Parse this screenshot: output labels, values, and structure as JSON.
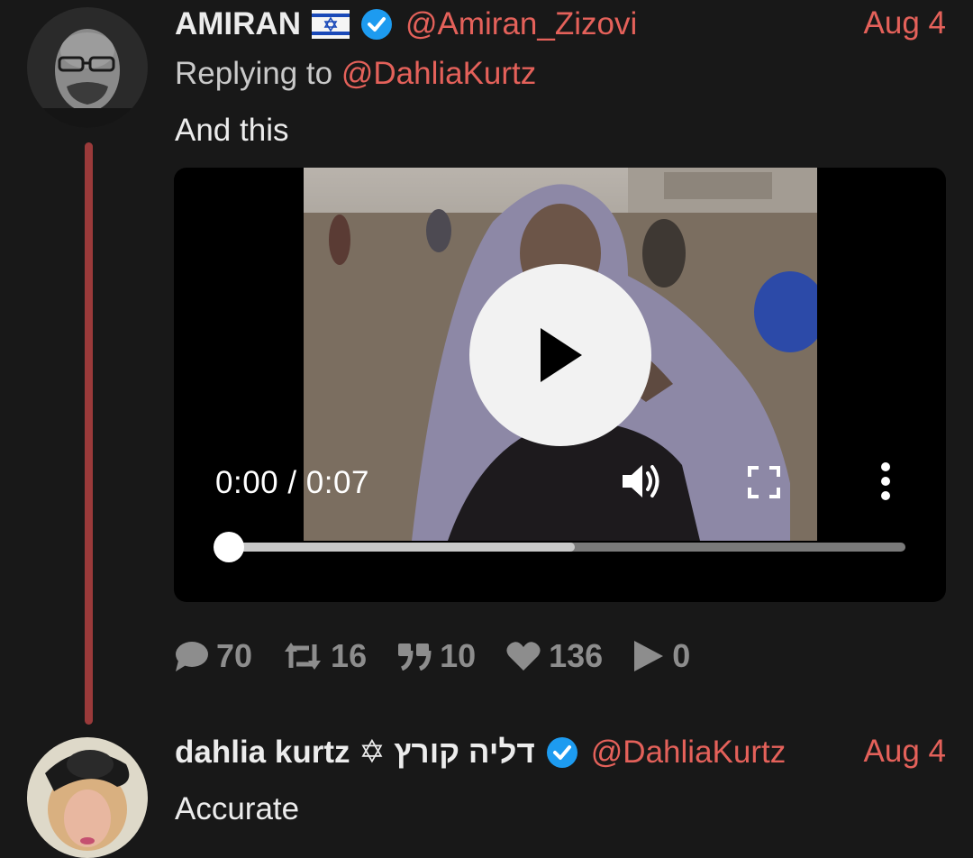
{
  "post1": {
    "name": "AMIRAN",
    "handle": "@Amiran_Zizovi",
    "date": "Aug 4",
    "replying_prefix": "Replying to ",
    "replying_handle": "@DahliaKurtz",
    "text": "And this",
    "icons": {
      "flag": "israel-flag-icon",
      "verified": "verified-badge-icon"
    },
    "video": {
      "time": "0:00 / 0:07",
      "buffered": 0.51,
      "played": 0,
      "icons": [
        "play-icon",
        "volume-icon",
        "fullscreen-icon",
        "more-vertical-icon"
      ]
    },
    "stats": {
      "replies": "70",
      "retweets": "16",
      "quotes": "10",
      "likes": "136",
      "views": "0"
    }
  },
  "post2": {
    "name": "dahlia kurtz ✡ דליה קורץ",
    "handle": "@DahliaKurtz",
    "date": "Aug 4",
    "text": "Accurate"
  },
  "colors": {
    "background": "#181818",
    "accent": "#e4615a",
    "thread_line": "#9a3a3a",
    "verified": "#1d9bf0",
    "stats": "#8d8d8d"
  }
}
